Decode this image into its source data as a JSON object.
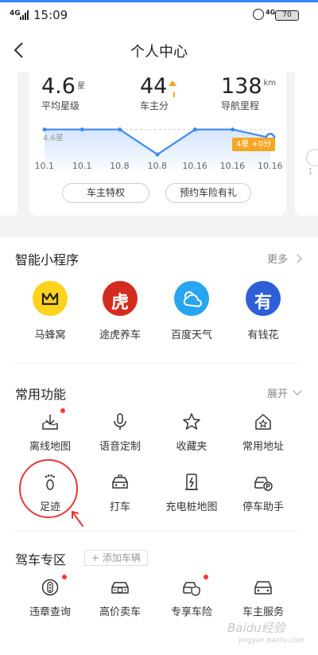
{
  "status_bar": {
    "signal": "4G",
    "time": "15:09",
    "network": "4G",
    "battery": "70"
  },
  "header": {
    "title": "个人中心"
  },
  "stats": {
    "rating": {
      "value": "4.6",
      "unit": "星",
      "label": "平均星级"
    },
    "score": {
      "value": "44",
      "label": "车主分"
    },
    "mileage": {
      "value": "138",
      "unit": "km",
      "label": "导航里程"
    },
    "chart_ref_label": "4.6星",
    "score_tag": "4星 +0分",
    "actions": [
      "车主特权",
      "预约车险有礼"
    ]
  },
  "side_card_digit": "1",
  "chart_data": {
    "type": "line",
    "x": [
      "10.1",
      "10.1",
      "10.8",
      "10.8",
      "10.16",
      "10.16",
      "10.16"
    ],
    "series": [
      {
        "values": [
          4.6,
          4.6,
          4.6,
          4.0,
          4.6,
          4.6,
          4.4
        ]
      }
    ],
    "reference_line": 4.6,
    "ylim": [
      3.6,
      4.9
    ],
    "color": "#3d8af7"
  },
  "mini_programs": {
    "title": "智能小程序",
    "more": "更多",
    "items": [
      {
        "name": "马蜂窝",
        "icon": "mafengwo-icon",
        "color": "#ffd21e"
      },
      {
        "name": "途虎养车",
        "icon": "tuhu-icon",
        "color": "#d42b1f",
        "glyph": "虎"
      },
      {
        "name": "百度天气",
        "icon": "weather-icon",
        "color": "#29a4f0"
      },
      {
        "name": "有钱花",
        "icon": "youqianhua-icon",
        "color": "#2f5fd7",
        "glyph": "有"
      }
    ]
  },
  "common_functions": {
    "title": "常用功能",
    "expand": "展开",
    "items": [
      "离线地图",
      "语音定制",
      "收藏夹",
      "常用地址",
      "足迹",
      "打车",
      "充电桩地图",
      "停车助手"
    ]
  },
  "driving": {
    "title": "驾车专区",
    "add_vehicle": "添加车辆",
    "items": [
      "违章查询",
      "高价卖车",
      "专享车险",
      "车主服务"
    ]
  },
  "watermark": {
    "text": "Baidu经验",
    "sub": "jingyan.baidu.com"
  },
  "colors": {
    "accent": "#3385ff",
    "chart_line": "#3d8af7",
    "tag": "#f5a623",
    "annotation": "#e53935"
  }
}
